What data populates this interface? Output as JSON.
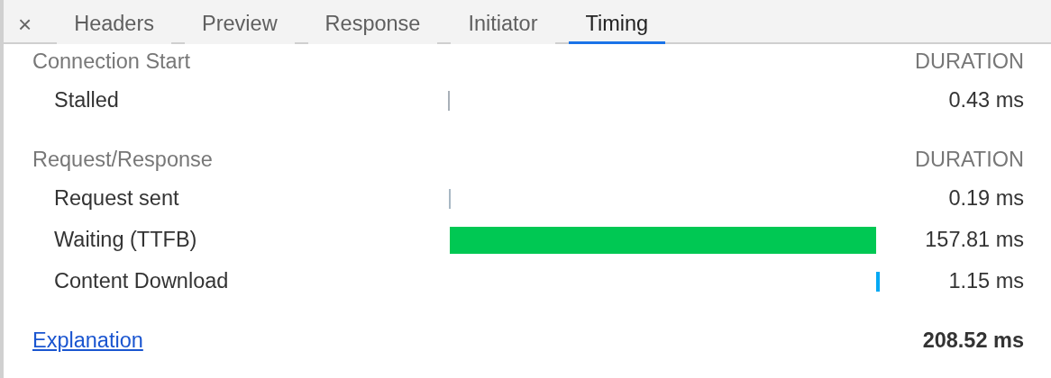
{
  "close": "×",
  "tabs": [
    {
      "label": "Headers",
      "selected": false
    },
    {
      "label": "Preview",
      "selected": false
    },
    {
      "label": "Response",
      "selected": false
    },
    {
      "label": "Initiator",
      "selected": false
    },
    {
      "label": "Timing",
      "selected": true
    }
  ],
  "sections": [
    {
      "title": "Connection Start",
      "column": "DURATION",
      "rows": [
        {
          "label": "Stalled",
          "duration": "0.43 ms",
          "color": "#a8b0b8"
        }
      ]
    },
    {
      "title": "Request/Response",
      "column": "DURATION",
      "rows": [
        {
          "label": "Request sent",
          "duration": "0.19 ms",
          "color": "#a8b8c4"
        },
        {
          "label": "Waiting (TTFB)",
          "duration": "157.81 ms",
          "color": "#00c853"
        },
        {
          "label": "Content Download",
          "duration": "1.15 ms",
          "color": "#03a9f4"
        }
      ]
    }
  ],
  "footer": {
    "link": "Explanation",
    "total": "208.52 ms"
  }
}
